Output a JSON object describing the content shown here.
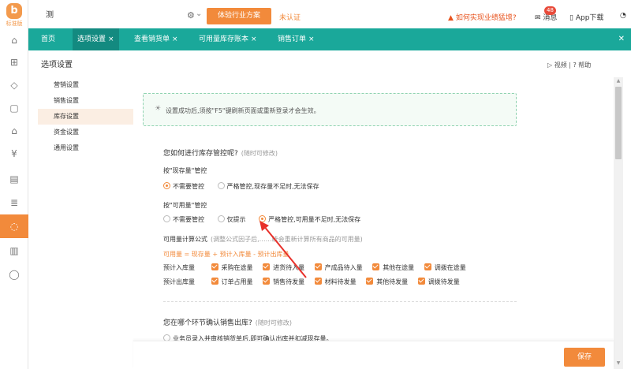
{
  "topbar": {
    "company": "测",
    "trial_button": "体验行业方案",
    "uncertified": "未认证",
    "promo": "如何实现业绩猛增?",
    "messages_label": "消息",
    "messages_badge": "48",
    "app_download": "App下载"
  },
  "logo": {
    "mark": "b",
    "edition": "标准版"
  },
  "tabs": [
    {
      "label": "首页",
      "closable": false
    },
    {
      "label": "选项设置",
      "closable": true
    },
    {
      "label": "查看销货单",
      "closable": true
    },
    {
      "label": "可用量库存账本",
      "closable": true
    },
    {
      "label": "销售订单",
      "closable": true
    }
  ],
  "page": {
    "title": "选项设置",
    "video": "视频",
    "help": "帮助"
  },
  "subnav": [
    "营销设置",
    "销售设置",
    "库存设置",
    "资金设置",
    "通用设置"
  ],
  "subnav_active": "库存设置",
  "notice": "设置成功后,须按\"F5\"键刷新页面或重新登录才会生效。",
  "stock_control": {
    "question": "您如何进行库存管控呢?",
    "hint": "(随时可修改)",
    "by_onhand": {
      "title": "按\"现存量\"管控",
      "options": [
        "不需要管控",
        "严格管控,现存量不足时,无法保存"
      ],
      "selected": 0
    },
    "by_available": {
      "title": "按\"可用量\"管控",
      "options": [
        "不需要管控",
        "仅提示",
        "严格管控,可用量不足时,无法保存"
      ],
      "selected": 2
    },
    "formula_label": "可用量计算公式",
    "formula_hint": "(调整公式因子后,……统会重新计算所有商品的可用量)",
    "formula": "可用量 = 现存量 + 预计入库量 - 预计出库量",
    "inbound": {
      "label": "预计入库量",
      "items": [
        "采购在途量",
        "进货待入量",
        "产成品待入量",
        "其他在途量",
        "调拨在途量"
      ]
    },
    "outbound": {
      "label": "预计出库量",
      "items": [
        "订单占用量",
        "销售待发量",
        "材料待发量",
        "其他待发量",
        "调拨待发量"
      ]
    }
  },
  "sales_out": {
    "question": "您在哪个环节确认销售出库?",
    "hint": "(随时可修改)",
    "option": "业务员录入并审核销货单后,即可确认出库并扣减现存量。"
  },
  "footer": {
    "save": "保存"
  },
  "colors": {
    "accent": "#f28a3b",
    "teal": "#1aa89a",
    "teal_dark": "#138a80"
  }
}
